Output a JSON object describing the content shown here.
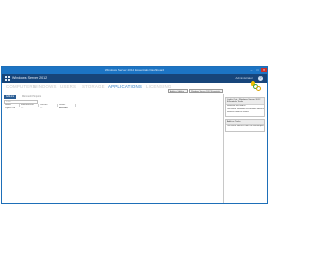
{
  "window": {
    "title": "Windows Server 2012 Essentials Dashboard",
    "controls": {
      "minimize": "–",
      "maximize": "□",
      "close": "✕"
    }
  },
  "app": {
    "title": "Windows Server 2012",
    "admin": "Administrator",
    "help": "?"
  },
  "nav": {
    "tabs": [
      {
        "label": "COMPUTERS",
        "active": false
      },
      {
        "label": "WINDOWS",
        "active": false
      },
      {
        "label": "USERS",
        "active": false
      },
      {
        "label": "STORAGE",
        "active": false
      },
      {
        "label": "APPLICATIONS",
        "active": true
      },
      {
        "label": "LICENSING",
        "active": false
      }
    ]
  },
  "actions": [
    {
      "label": "Add-ins / Add-in"
    },
    {
      "label": "Windows Server 2012 Essentials"
    }
  ],
  "subtabs": [
    {
      "label": "Add-ins",
      "active": true
    },
    {
      "label": "Microsoft Pinpoint",
      "active": false
    }
  ],
  "filter": {
    "placeholder": "Filter"
  },
  "table": {
    "columns": [
      "Name",
      "Manufacturer",
      "Version",
      "Status"
    ],
    "rows": [
      [
        "Lights Out",
        "—",
        "—",
        "Available"
      ]
    ]
  },
  "panels": {
    "tasks_title": "Lights Out - Windows Server 2012 Essentials Tasks",
    "tasks": [
      "Remove the add-in",
      "Get more Windows Essentials add-ins",
      "Refresh add-ins status"
    ],
    "add_ins_title": "Add-ins Tasks",
    "add_ins": [
      "Get more add-ins from the Marketplace"
    ]
  },
  "colors": {
    "window_border": "#1e6fb8",
    "title_bar": "#1c74c4",
    "app_bar": "#17457a",
    "active_tab": "#2f7cc3",
    "inactive_tab": "#c9c9c9",
    "close_button": "#c8312a"
  },
  "icons": {
    "logo": "windows-logo-icon",
    "help": "help-icon",
    "notifications": "lightbulb-icon",
    "health": "health-circles-icon"
  }
}
